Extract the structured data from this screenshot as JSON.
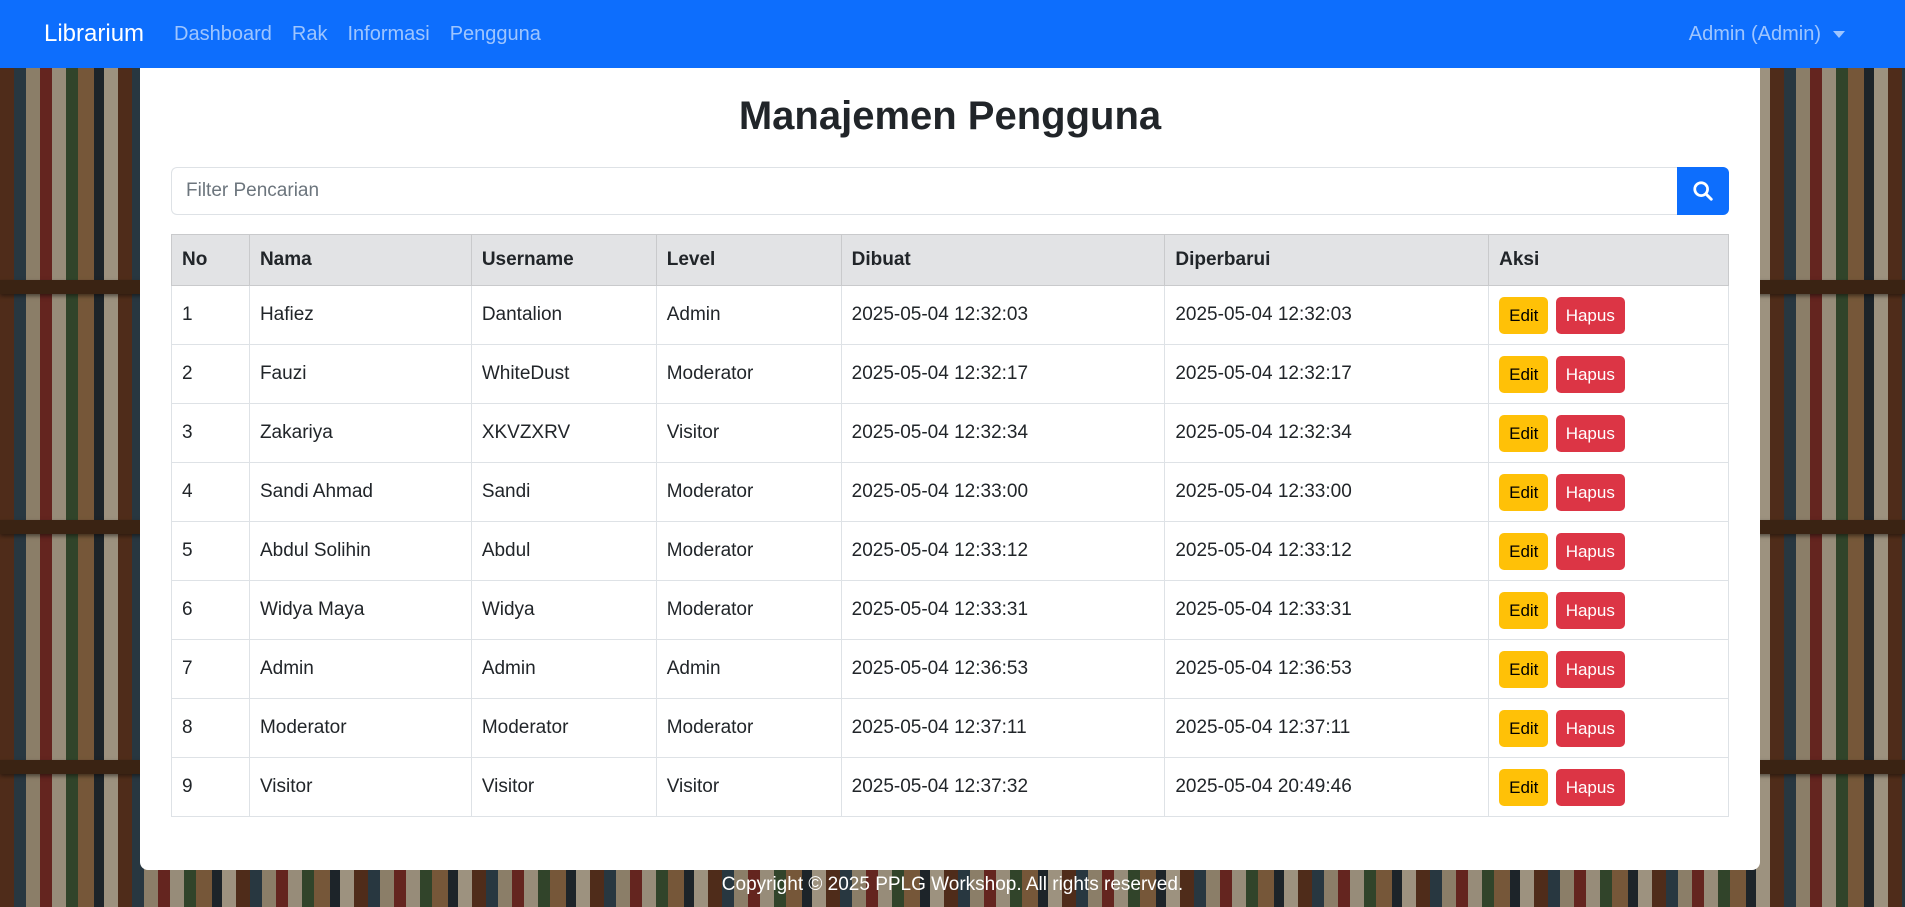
{
  "navbar": {
    "brand": "Librarium",
    "links": [
      "Dashboard",
      "Rak",
      "Informasi",
      "Pengguna"
    ],
    "user": "Admin (Admin)",
    "color": "#0d6efd"
  },
  "page": {
    "title": "Manajemen Pengguna"
  },
  "search": {
    "placeholder": "Filter Pencarian",
    "value": "",
    "icon": "search-icon"
  },
  "table": {
    "headers": [
      "No",
      "Nama",
      "Username",
      "Level",
      "Dibuat",
      "Diperbarui",
      "Aksi"
    ],
    "edit_label": "Edit",
    "delete_label": "Hapus",
    "rows": [
      [
        "1",
        "Hafiez",
        "Dantalion",
        "Admin",
        "2025-05-04 12:32:03",
        "2025-05-04 12:32:03"
      ],
      [
        "2",
        "Fauzi",
        "WhiteDust",
        "Moderator",
        "2025-05-04 12:32:17",
        "2025-05-04 12:32:17"
      ],
      [
        "3",
        "Zakariya",
        "XKVZXRV",
        "Visitor",
        "2025-05-04 12:32:34",
        "2025-05-04 12:32:34"
      ],
      [
        "4",
        "Sandi Ahmad",
        "Sandi",
        "Moderator",
        "2025-05-04 12:33:00",
        "2025-05-04 12:33:00"
      ],
      [
        "5",
        "Abdul Solihin",
        "Abdul",
        "Moderator",
        "2025-05-04 12:33:12",
        "2025-05-04 12:33:12"
      ],
      [
        "6",
        "Widya Maya",
        "Widya",
        "Moderator",
        "2025-05-04 12:33:31",
        "2025-05-04 12:33:31"
      ],
      [
        "7",
        "Admin",
        "Admin",
        "Admin",
        "2025-05-04 12:36:53",
        "2025-05-04 12:36:53"
      ],
      [
        "8",
        "Moderator",
        "Moderator",
        "Moderator",
        "2025-05-04 12:37:11",
        "2025-05-04 12:37:11"
      ],
      [
        "9",
        "Visitor",
        "Visitor",
        "Visitor",
        "2025-05-04 12:37:32",
        "2025-05-04 20:49:46"
      ]
    ]
  },
  "footer": {
    "text": "Copyright © 2025 PPLG Workshop. All rights reserved."
  },
  "colors": {
    "edit": "#ffc107",
    "delete": "#dc3545",
    "header_bg": "#e2e3e5"
  }
}
